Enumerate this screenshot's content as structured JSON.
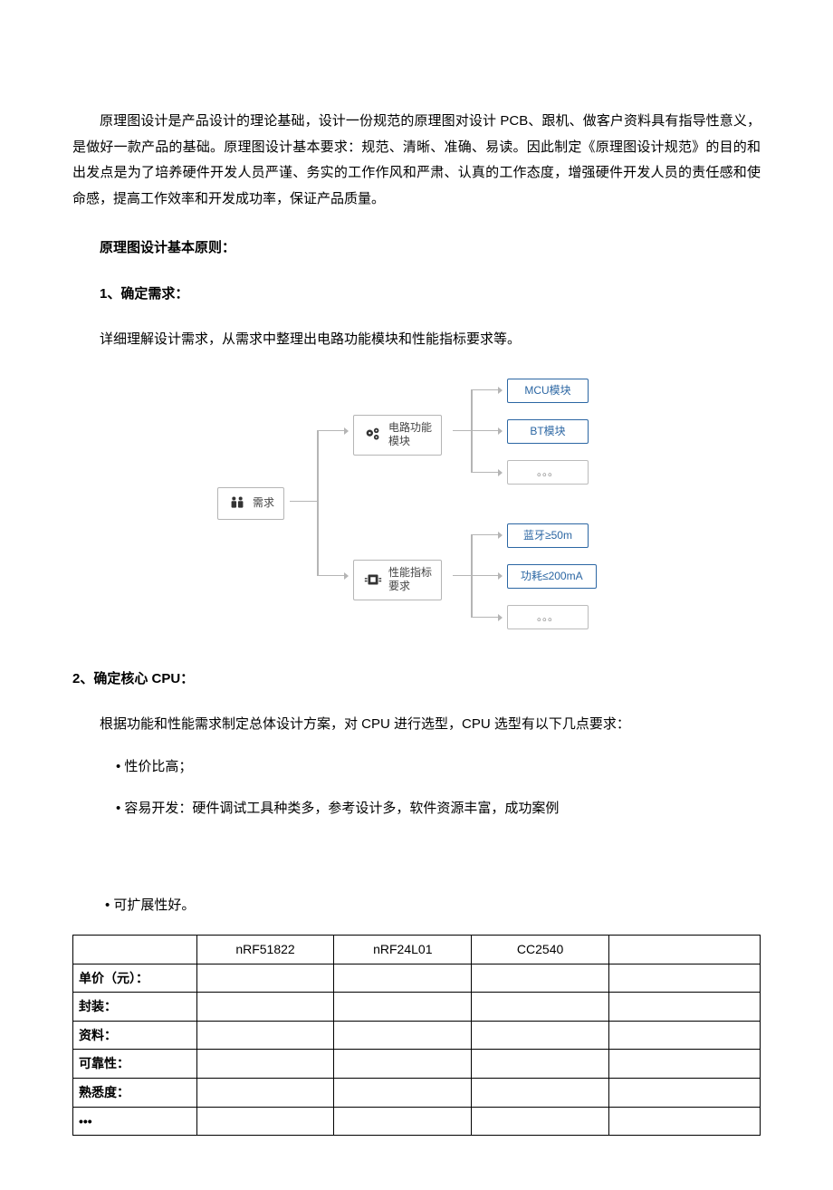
{
  "intro": "原理图设计是产品设计的理论基础，设计一份规范的原理图对设计 PCB、跟机、做客户资料具有指导性意义，是做好一款产品的基础。原理图设计基本要求：规范、清晰、准确、易读。因此制定《原理图设计规范》的目的和出发点是为了培养硬件开发人员严谨、务实的工作作风和严肃、认真的工作态度，增强硬件开发人员的责任感和使命感，提高工作效率和开发成功率，保证产品质量。",
  "principles_heading": "原理图设计基本原则：",
  "s1_heading": "1、确定需求：",
  "s1_body": "详细理解设计需求，从需求中整理出电路功能模块和性能指标要求等。",
  "diagram": {
    "root": "需求",
    "branch1": "电路功能\n模块",
    "branch2": "性能指标\n要求",
    "leaves": {
      "l1": "MCU模块",
      "l2": "BT模块",
      "l3": "。。。",
      "l4": "蓝牙≥50m",
      "l5": "功耗≤200mA",
      "l6": "。。。"
    }
  },
  "s2_heading": "2、确定核心 CPU：",
  "s2_body": "根据功能和性能需求制定总体设计方案，对 CPU 进行选型，CPU 选型有以下几点要求：",
  "bullets1": [
    "性价比高；",
    "容易开发：硬件调试工具种类多，参考设计多，软件资源丰富，成功案例"
  ],
  "bullets2": [
    "可扩展性好。"
  ],
  "table": {
    "headers": [
      "",
      "nRF51822",
      "nRF24L01",
      "CC2540",
      ""
    ],
    "rows": [
      {
        "label": "单价（元）：",
        "c": [
          "",
          "",
          "",
          ""
        ]
      },
      {
        "label": "封装：",
        "c": [
          "",
          "",
          "",
          ""
        ]
      },
      {
        "label": "资料：",
        "c": [
          "",
          "",
          "",
          ""
        ]
      },
      {
        "label": "可靠性：",
        "c": [
          "",
          "",
          "",
          ""
        ]
      },
      {
        "label": "熟悉度：",
        "c": [
          "",
          "",
          "",
          ""
        ]
      },
      {
        "label": "•••",
        "c": [
          "",
          "",
          "",
          ""
        ]
      }
    ]
  }
}
